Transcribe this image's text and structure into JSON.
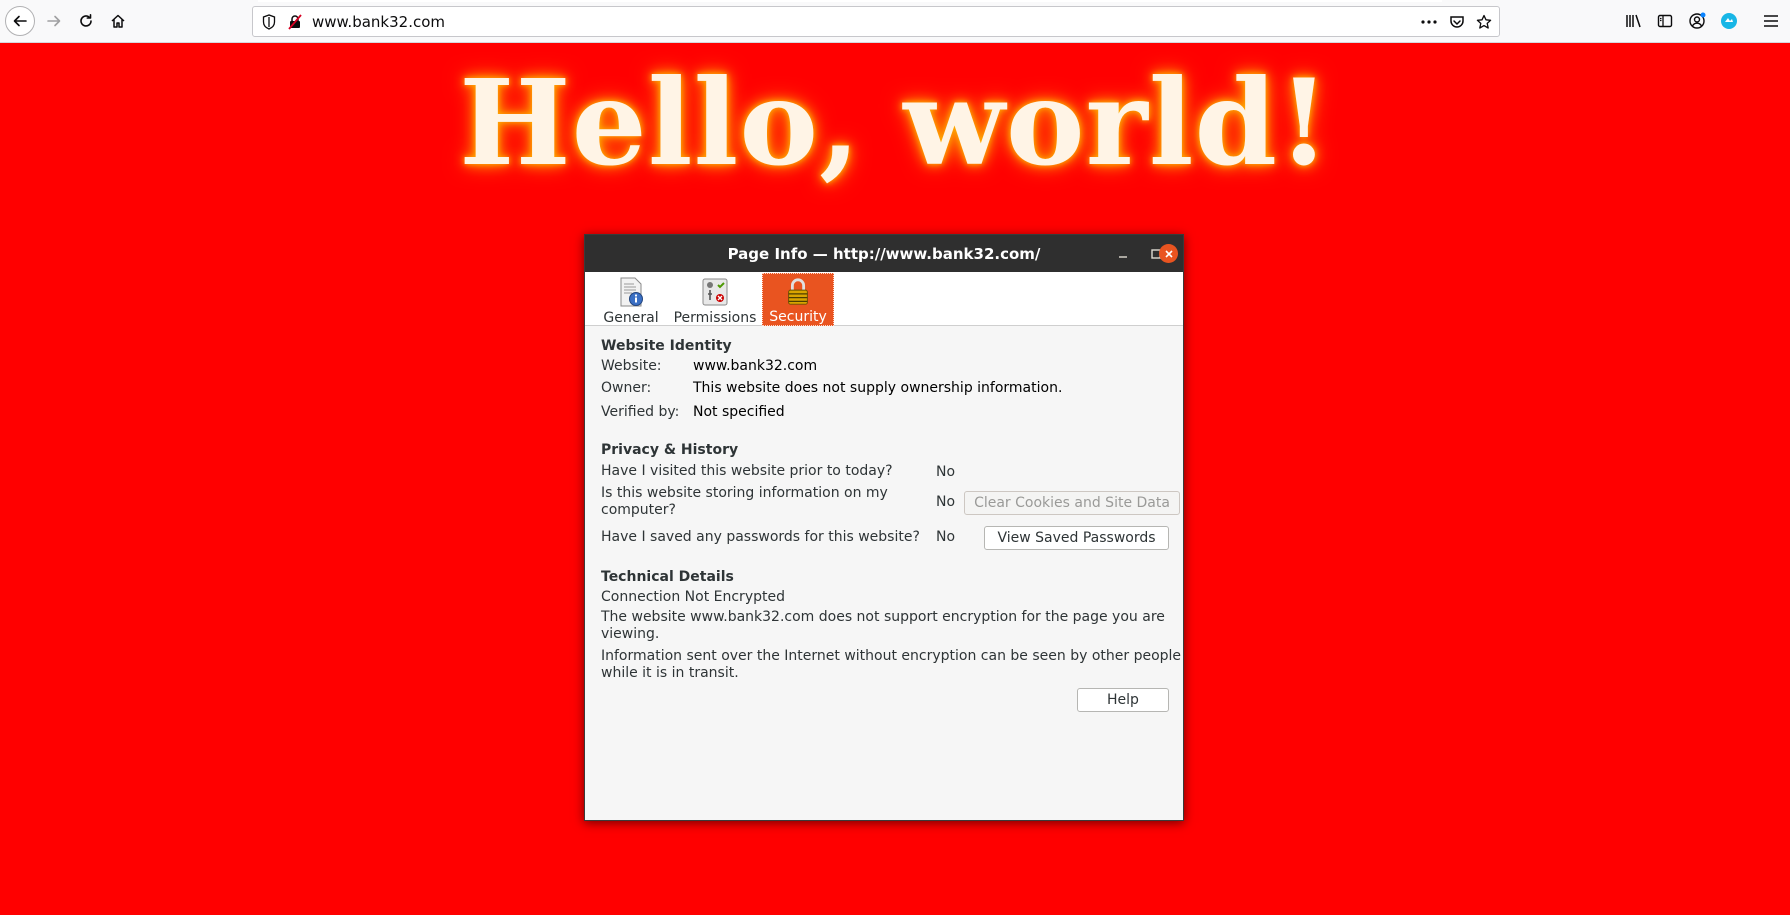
{
  "browser": {
    "url": "www.bank32.com",
    "nav_icons": [
      "back-arrow-icon",
      "forward-arrow-icon",
      "reload-icon",
      "home-icon"
    ],
    "right_icons": [
      "library-icon",
      "sidebar-icon",
      "account-icon",
      "extension-icon",
      "hamburger-menu-icon"
    ],
    "url_icons": [
      "tracking-protection-icon",
      "insecure-lock-icon",
      "page-actions-icon",
      "pocket-icon",
      "bookmark-star-icon"
    ]
  },
  "page": {
    "headline": "Hello, world!",
    "background_color": "#ff0000"
  },
  "dialog": {
    "title": "Page Info — http://www.bank32.com/",
    "tabs": [
      {
        "label": "General",
        "selected": false
      },
      {
        "label": "Permissions",
        "selected": false
      },
      {
        "label": "Security",
        "selected": true
      }
    ],
    "identity": {
      "heading": "Website Identity",
      "website_label": "Website:",
      "website_value": "www.bank32.com",
      "owner_label": "Owner:",
      "owner_value": "This website does not supply ownership information.",
      "verified_label": "Verified by:",
      "verified_value": "Not specified"
    },
    "privacy": {
      "heading": "Privacy & History",
      "q1": "Have I visited this website prior to today?",
      "a1": "No",
      "q2_line1": "Is this website storing information on my",
      "q2_line2": "computer?",
      "a2": "No",
      "clear_button": "Clear Cookies and Site Data",
      "q3": "Have I saved any passwords for this website?",
      "a3": "No",
      "view_button": "View Saved Passwords"
    },
    "technical": {
      "heading": "Technical Details",
      "status": "Connection Not Encrypted",
      "line1a": "The website www.bank32.com does not support encryption for the page you are",
      "line1b": "viewing.",
      "line2a": "Information sent over the Internet without encryption can be seen by other people",
      "line2b": "while it is in transit."
    },
    "help_button": "Help",
    "accent_color": "#e95420"
  }
}
